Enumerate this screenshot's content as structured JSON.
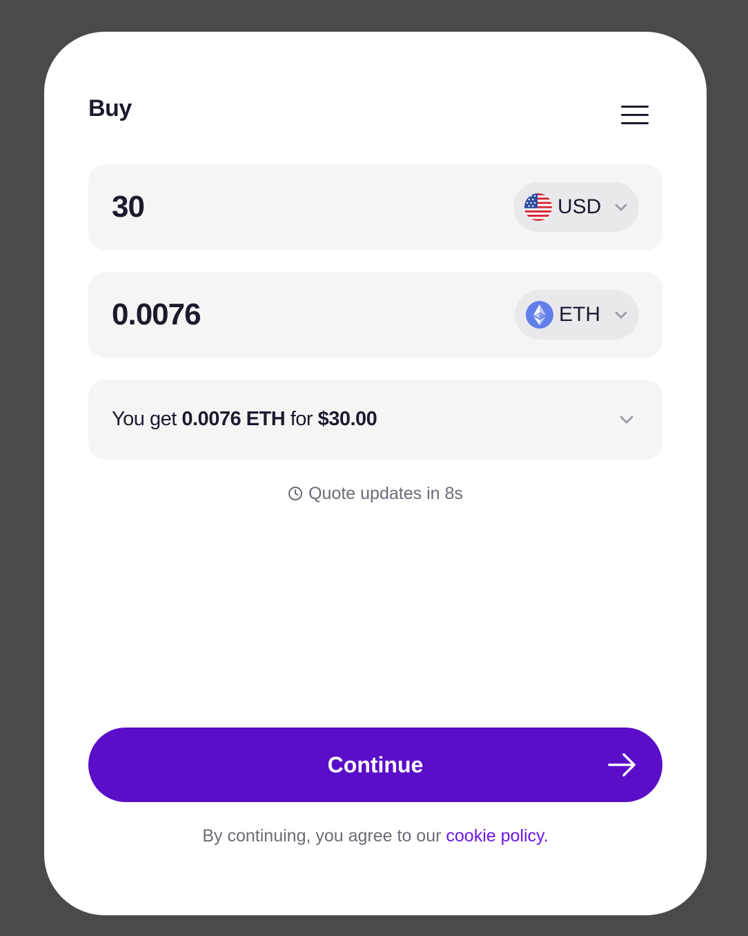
{
  "header": {
    "title": "Buy",
    "menu_icon": "hamburger-menu-icon"
  },
  "fiat": {
    "amount": "30",
    "currency_code": "USD",
    "currency_icon": "us-flag-icon"
  },
  "crypto": {
    "amount": "0.0076",
    "currency_code": "ETH",
    "currency_icon": "ethereum-icon"
  },
  "quote": {
    "prefix": "You get",
    "crypto_amount": "0.0076 ETH",
    "middle": "for",
    "fiat_total": "$30.00"
  },
  "timer": {
    "text": "Quote updates in 8s",
    "icon": "clock-icon"
  },
  "continue_button": {
    "label": "Continue",
    "icon": "arrow-right-icon"
  },
  "legal": {
    "prefix": "By continuing, you agree to our",
    "link_text": "cookie policy",
    "suffix": "."
  },
  "colors": {
    "accent": "#5b0ec8",
    "link": "#6d14e6",
    "background": "#4a4a4a",
    "card": "#ffffff",
    "field": "#f5f5f6",
    "text": "#1b1a2e",
    "muted": "#6b6b78"
  }
}
